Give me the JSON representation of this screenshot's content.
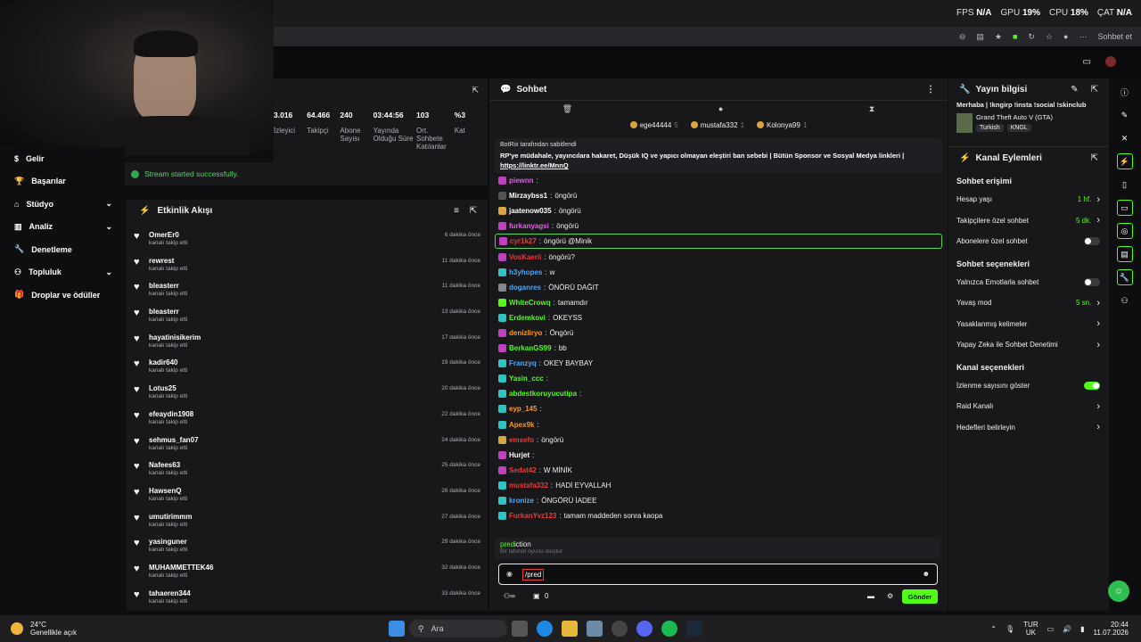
{
  "topstats": {
    "fps_label": "FPS",
    "fps": "N/A",
    "gpu_label": "GPU",
    "gpu": "19%",
    "cpu_label": "CPU",
    "cpu": "18%",
    "cat": "ÇAT",
    "cat_val": "N/A"
  },
  "browser": {
    "sohbet_et": "Sohbet et"
  },
  "nav": {
    "items": [
      {
        "label": "Gelir",
        "chev": false
      },
      {
        "label": "Başarılar",
        "chev": false
      },
      {
        "label": "Stüdyo",
        "chev": true
      },
      {
        "label": "Analiz",
        "chev": true
      },
      {
        "label": "Denetleme",
        "chev": false
      },
      {
        "label": "Topluluk",
        "chev": true
      },
      {
        "label": "Droplar ve ödüller",
        "chev": false
      }
    ]
  },
  "stats": [
    {
      "value": "3.016",
      "label": "İzleyici"
    },
    {
      "value": "64.466",
      "label": "Takipçi"
    },
    {
      "value": "240",
      "label": "Abone Sayısı"
    },
    {
      "value": "03:44:56",
      "label": "Yayında Olduğu Süre"
    },
    {
      "value": "103",
      "label": "Ort. Sohbete Katılanlar"
    },
    {
      "value": "%3",
      "label": "Kat"
    }
  ],
  "success": "Stream started successfully.",
  "feed": {
    "title": "Etkinlik Akışı",
    "sub": "kanalı takip etti",
    "items": [
      {
        "name": "OmerEr0",
        "time": "6 dakika önce"
      },
      {
        "name": "rewrest",
        "time": "11 dakika önce"
      },
      {
        "name": "bleasterr",
        "time": "11 dakika önce"
      },
      {
        "name": "bleasterr",
        "time": "13 dakika önce"
      },
      {
        "name": "hayatinisikerim",
        "time": "17 dakika önce"
      },
      {
        "name": "kadir640",
        "time": "19 dakika önce"
      },
      {
        "name": "Lotus25",
        "time": "20 dakika önce"
      },
      {
        "name": "efeaydin1908",
        "time": "22 dakika önce"
      },
      {
        "name": "sehmus_fan07",
        "time": "24 dakika önce"
      },
      {
        "name": "Nafees63",
        "time": "25 dakika önce"
      },
      {
        "name": "HawsenQ",
        "time": "26 dakika önce"
      },
      {
        "name": "umutirimmm",
        "time": "27 dakika önce"
      },
      {
        "name": "yasinguner",
        "time": "29 dakika önce"
      },
      {
        "name": "MUHAMMETTEK46",
        "time": "32 dakika önce"
      },
      {
        "name": "tahaeren344",
        "time": "33 dakika önce"
      }
    ]
  },
  "chat": {
    "title": "Sohbet",
    "gifters": [
      {
        "name": "ege44444",
        "n": "5"
      },
      {
        "name": "mustafa332",
        "n": "1"
      },
      {
        "name": "Kolonya99",
        "n": "1"
      }
    ],
    "pinned_by": "BotRix tarafından sabitlendi",
    "pinned_text": "RP'ye müdahale, yayıncılara hakaret, Düşük IQ ve yapıcı olmayan eleştiri ban sebebi | Bütün Sponsor ve Sosyal Medya linkleri |",
    "pinned_link": "https://linktr.ee/MnnQ",
    "messages": [
      {
        "user": "piewnn",
        "text": "",
        "color": "#e060e0",
        "badge": "#c040c0"
      },
      {
        "user": "Mirzaybss1",
        "text": "öngörü",
        "color": "#ffffff",
        "badge": "#555"
      },
      {
        "user": "jaatenow035",
        "text": "öngörü",
        "color": "#ffffff",
        "badge": "#d9a63a"
      },
      {
        "user": "furkanyagsi",
        "text": "öngörü",
        "color": "#e060e0",
        "badge": "#c040c0"
      },
      {
        "user": "cyr1k27",
        "text": "öngörü @Minik",
        "color": "#e83a3a",
        "badge": "#c040c0",
        "hl": true
      },
      {
        "user": "VosKaerii",
        "text": "öngörü?",
        "color": "#e83a3a",
        "badge": "#c040c0"
      },
      {
        "user": "h3yhopes",
        "text": "w",
        "color": "#4aa8ff",
        "badge": "#2ec4c4"
      },
      {
        "user": "doganres",
        "text": "ÖNÖRÜ DAĞIT",
        "color": "#4aa8ff",
        "badge": "#888"
      },
      {
        "user": "WhiteCrowq",
        "text": "tamamdır",
        "color": "#53fc18",
        "badge": "#53fc18"
      },
      {
        "user": "Erdemkovi",
        "text": "OKEYSS",
        "color": "#53fc18",
        "badge": "#2ec4c4"
      },
      {
        "user": "denizliryo",
        "text": "Öngörü",
        "color": "#f59a23",
        "badge": "#c040c0"
      },
      {
        "user": "BerkanGS99",
        "text": "bb",
        "color": "#53fc18",
        "badge": "#c040c0"
      },
      {
        "user": "Franzyq",
        "text": "OKEY BAYBAY",
        "color": "#4aa8ff",
        "badge": "#2ec4c4"
      },
      {
        "user": "Yasin_ccc",
        "text": "",
        "color": "#53fc18",
        "badge": "#2ec4c4"
      },
      {
        "user": "abdestkoruyucutipa",
        "text": "",
        "color": "#53fc18",
        "badge": "#2ec4c4"
      },
      {
        "user": "eyp_145",
        "text": "",
        "color": "#f59a23",
        "badge": "#2ec4c4"
      },
      {
        "user": "Apex9k",
        "text": "",
        "color": "#f59a23",
        "badge": "#2ec4c4"
      },
      {
        "user": "emsefo",
        "text": "öngörü",
        "color": "#e83a3a",
        "badge": "#d9a63a"
      },
      {
        "user": "Hurjet",
        "text": "",
        "color": "#ffffff",
        "badge": "#c040c0"
      },
      {
        "user": "Sedat42",
        "text": "W MİNİK",
        "color": "#e83a3a",
        "badge": "#c040c0"
      },
      {
        "user": "mustafa332",
        "text": "HADİ EYVALLAH",
        "color": "#e83a3a",
        "badge": "#2ec4c4"
      },
      {
        "user": "kronize",
        "text": "ÖNGÖRÜ İADEE",
        "color": "#4aa8ff",
        "badge": "#2ec4c4"
      },
      {
        "user": "FurkanYvz123",
        "text": "tamam maddeden sonra kaopa",
        "color": "#e83a3a",
        "badge": "#2ec4c4"
      }
    ],
    "suggestion_cmd_hl": "pred",
    "suggestion_cmd_rest": "iction",
    "suggestion_desc": "Bir tahmin oyunu oluştur",
    "input_value": "/pred",
    "points": "0",
    "send": "Gönder"
  },
  "right": {
    "title": "Yayın bilgisi",
    "stream_title": "Merhaba | !kngirp !insta !social !skinclub",
    "game": "Grand Theft Auto V (GTA)",
    "tags": [
      "Turkish",
      "KNGL"
    ],
    "actions_title": "Kanal Eylemleri",
    "sec1": "Sohbet erişimi",
    "rows1": [
      {
        "label": "Hesap yaşı",
        "val": "1 hf."
      },
      {
        "label": "Takipçilere özel sohbet",
        "val": "5 dk."
      },
      {
        "label": "Abonelere özel sohbet",
        "toggle": false
      }
    ],
    "sec2": "Sohbet seçenekleri",
    "rows2": [
      {
        "label": "Yalnızca Emotlarla sohbet",
        "toggle": false
      },
      {
        "label": "Yavaş mod",
        "val": "5 sn."
      },
      {
        "label": "Yasaklanmış kelimeler",
        "val": ""
      },
      {
        "label": "Yapay Zeka ile Sohbet Denetimi",
        "val": ""
      }
    ],
    "sec3": "Kanal seçenekleri",
    "rows3": [
      {
        "label": "İzlenme sayısını göster",
        "toggle": true
      },
      {
        "label": "Raid Kanalı",
        "val": ""
      },
      {
        "label": "Hedefleri belirleyin",
        "val": ""
      }
    ]
  },
  "taskbar": {
    "temp": "24°C",
    "weather": "Genellikle açık",
    "search": "Ara",
    "lang": "TUR",
    "lang2": "UK",
    "time": "20:44",
    "date": "11.07.2026"
  }
}
